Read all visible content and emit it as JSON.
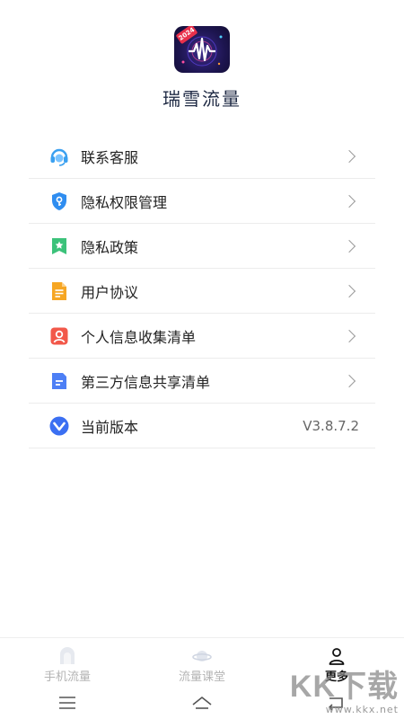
{
  "app": {
    "name": "瑞雪流量",
    "icon_badge": "2024",
    "icon": "waveform-app-icon"
  },
  "menu": {
    "items": [
      {
        "label": "联系客服",
        "icon": "headset-icon",
        "color": "#3aa0f0"
      },
      {
        "label": "隐私权限管理",
        "icon": "shield-key-icon",
        "color": "#2f8df0"
      },
      {
        "label": "隐私政策",
        "icon": "bookmark-star-icon",
        "color": "#3cc27a"
      },
      {
        "label": "用户协议",
        "icon": "document-icon",
        "color": "#f6a623"
      },
      {
        "label": "个人信息收集清单",
        "icon": "person-icon",
        "color": "#f2584a"
      },
      {
        "label": "第三方信息共享清单",
        "icon": "file-lines-icon",
        "color": "#4d7ff5"
      },
      {
        "label": "当前版本",
        "icon": "chevron-v-icon",
        "color": "#3b6ff2",
        "value": "V3.8.7.2"
      }
    ]
  },
  "bottom_nav": {
    "tabs": [
      {
        "label": "手机流量",
        "icon": "phone-traffic-icon",
        "active": false
      },
      {
        "label": "流量课堂",
        "icon": "planet-icon",
        "active": false
      },
      {
        "label": "更多",
        "icon": "person-outline-icon",
        "active": true
      }
    ]
  },
  "system_nav": {
    "buttons": [
      "menu-icon",
      "home-icon",
      "back-icon"
    ]
  },
  "watermark": {
    "text": "KK下载",
    "url": "www.kkx.net"
  }
}
